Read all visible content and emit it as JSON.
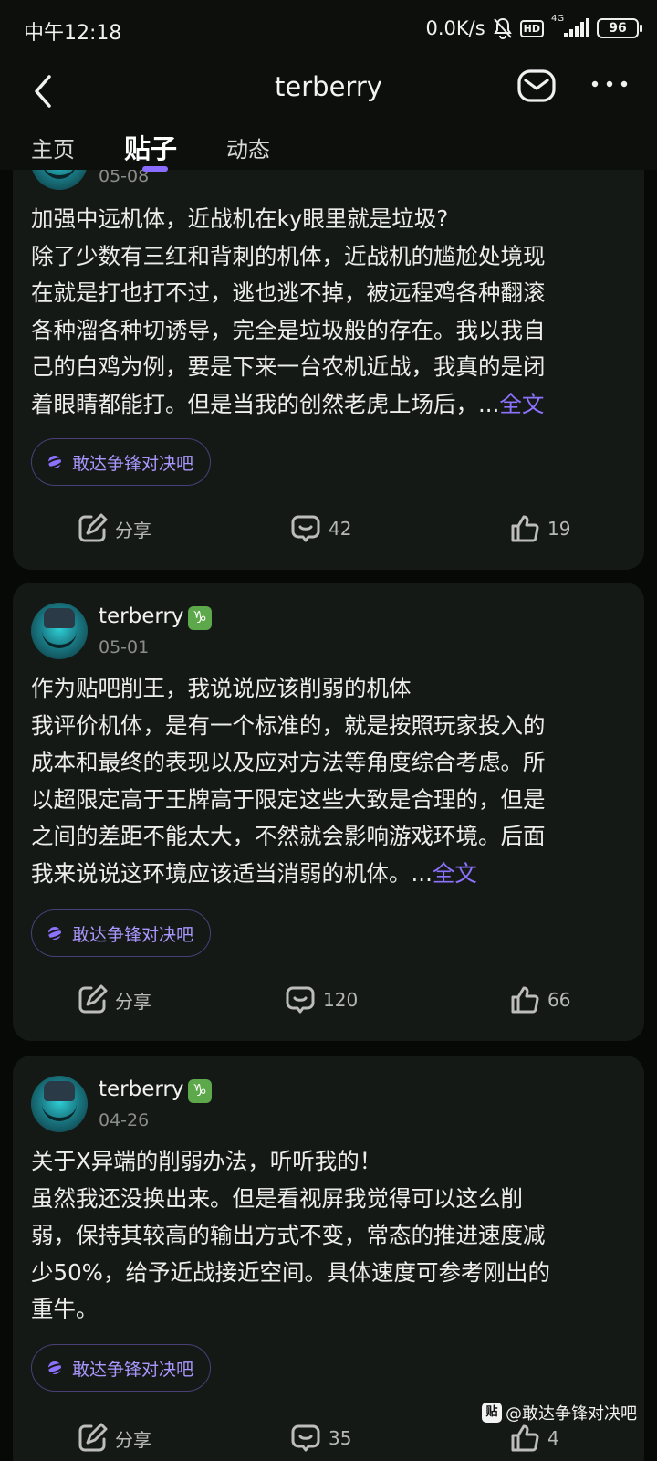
{
  "status_bar": {
    "time": "中午12:18",
    "net_speed": "0.0K/s",
    "hd": "HD",
    "signal_label": "4G",
    "battery": "96"
  },
  "header": {
    "title": "terberry",
    "mail_icon": "mail-icon",
    "more_icon": "more-icon"
  },
  "tabs": [
    {
      "label": "主页",
      "active": false
    },
    {
      "label": "贴子",
      "active": true
    },
    {
      "label": "动态",
      "active": false
    }
  ],
  "posts": [
    {
      "date": "05-08",
      "title": "加强中远机体，近战机在ky眼里就是垃圾?",
      "lines": [
        "除了少数有三红和背刺的机体，近战机的尴尬处境现",
        "在就是打也打不过，逃也逃不掉，被远程鸡各种翻滚",
        "各种溜各种切诱导，完全是垃圾般的存在。我以我自",
        "己的白鸡为例，要是下来一台农机近战，我真的是闭",
        "着眼睛都能打。但是当我的创然老虎上场后，"
      ],
      "more_prefix": "...",
      "more_label": "全文",
      "forum": "敢达争锋对决吧",
      "share_label": "分享",
      "comments": "42",
      "likes": "19"
    },
    {
      "author": "terberry",
      "badge": "♑",
      "date": "05-01",
      "title": "作为贴吧削王，我说说应该削弱的机体",
      "lines": [
        "我评价机体，是有一个标准的，就是按照玩家投入的",
        "成本和最终的表现以及应对方法等角度综合考虑。所",
        "以超限定高于王牌高于限定这些大致是合理的，但是",
        "之间的差距不能太大，不然就会影响游戏环境。后面",
        "我来说说这环境应该适当消弱的机体。"
      ],
      "more_prefix": "...",
      "more_label": "全文",
      "forum": "敢达争锋对决吧",
      "share_label": "分享",
      "comments": "120",
      "likes": "66"
    },
    {
      "author": "terberry",
      "badge": "♑",
      "date": "04-26",
      "title": "关于X异端的削弱办法，听听我的！",
      "lines": [
        "虽然我还没换出来。但是看视屏我觉得可以这么削",
        "弱，保持其较高的输出方式不变，常态的推进速度减",
        "少50%，给予近战接近空间。具体速度可参考刚出的",
        "重牛。"
      ],
      "forum": "敢达争锋对决吧",
      "share_label": "分享",
      "comments": "35",
      "likes": "4"
    }
  ],
  "watermark": {
    "logo": "贴",
    "text": "@敢达争锋对决吧"
  },
  "colors": {
    "background": "#060906",
    "card": "#151915",
    "accent": "#8c72ff"
  }
}
